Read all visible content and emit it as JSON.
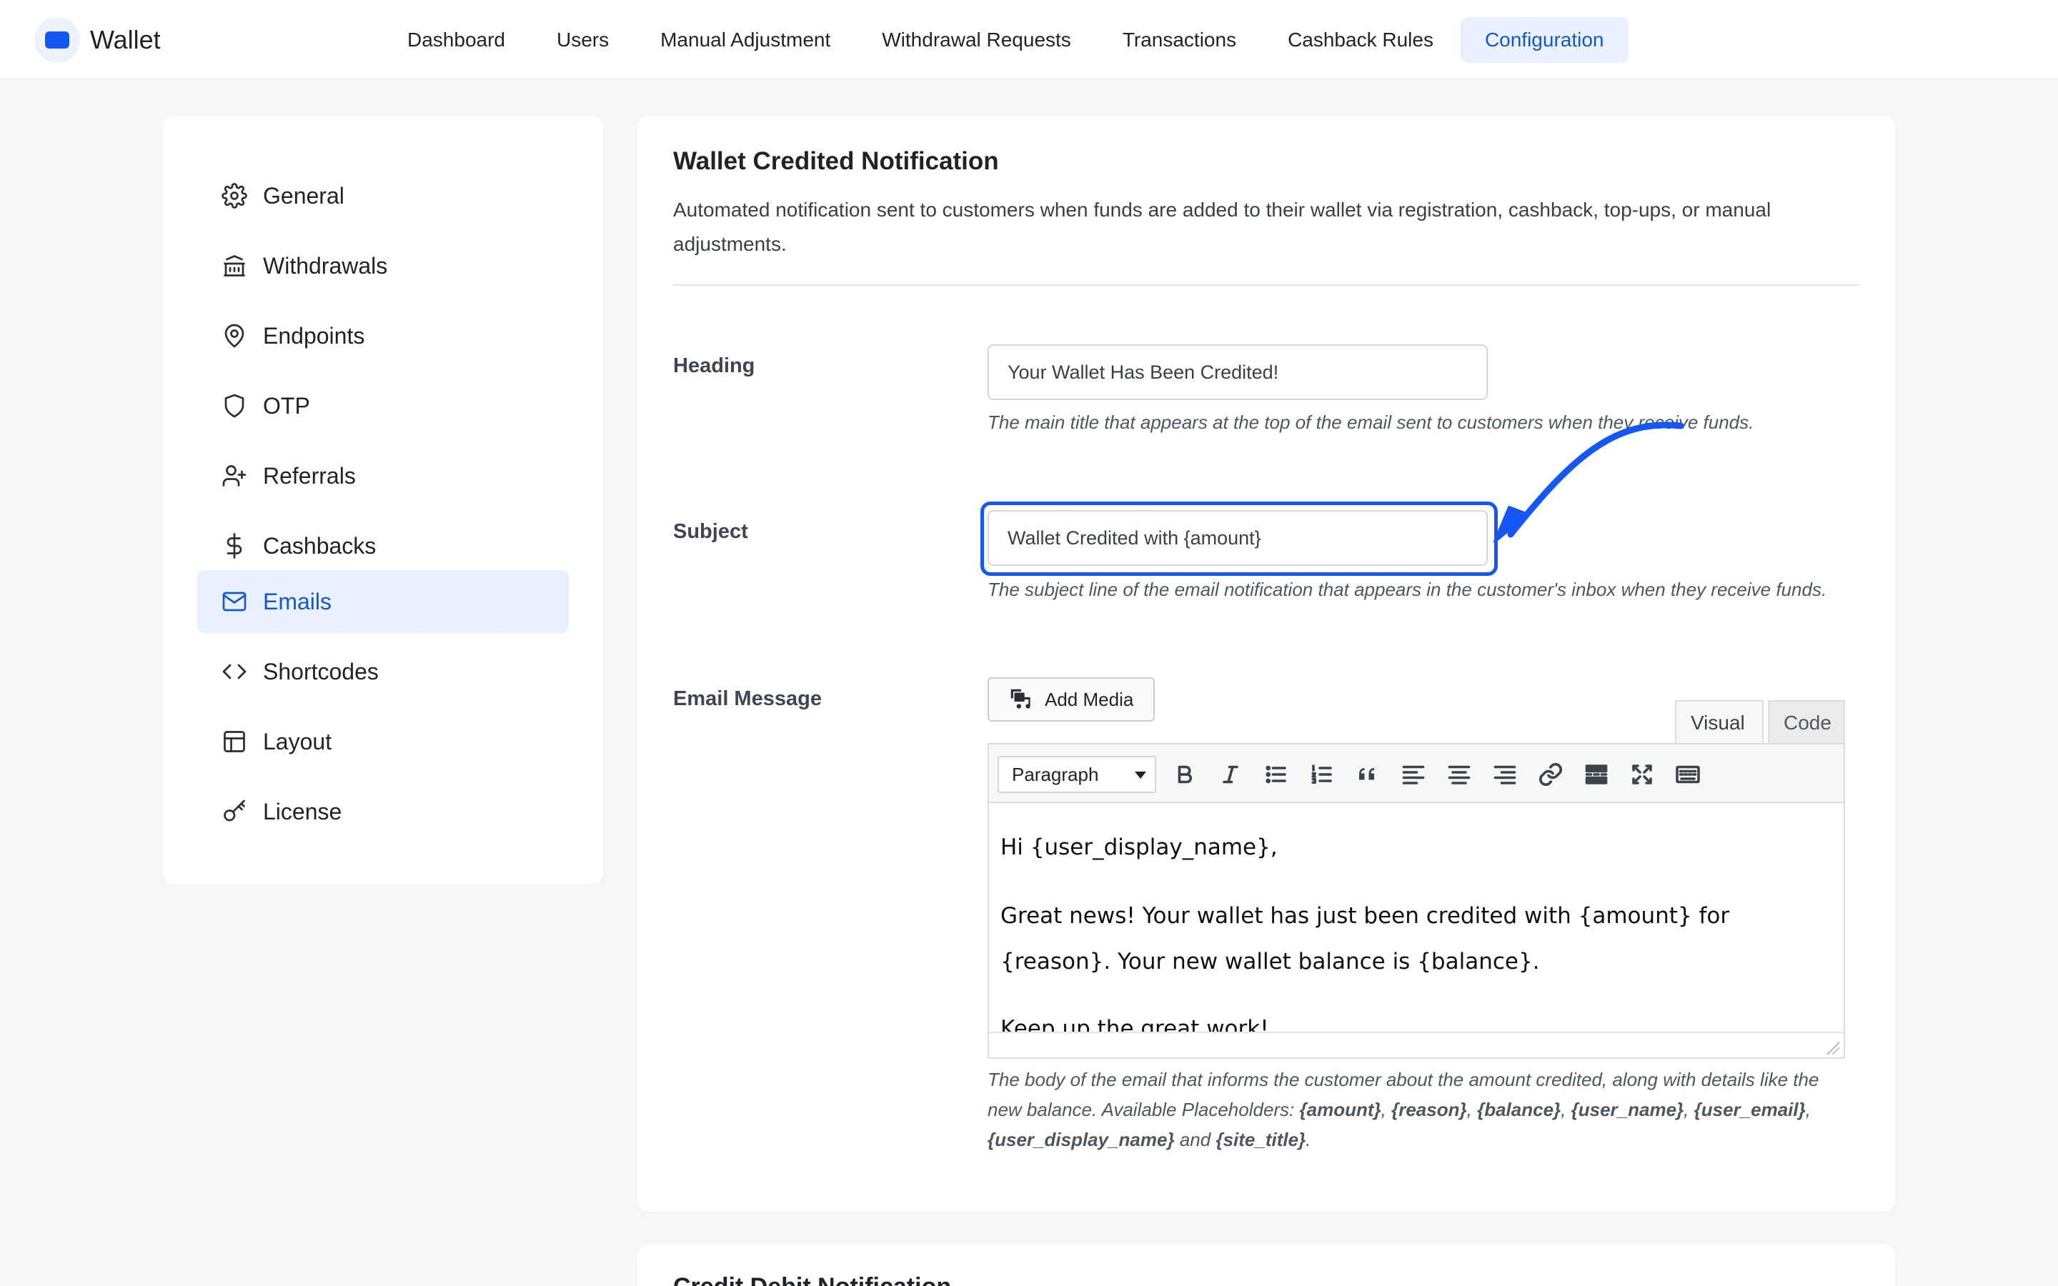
{
  "brand": {
    "name": "Wallet",
    "accent": "#1557f5"
  },
  "nav": {
    "items": [
      {
        "label": "Dashboard"
      },
      {
        "label": "Users"
      },
      {
        "label": "Manual Adjustment"
      },
      {
        "label": "Withdrawal Requests"
      },
      {
        "label": "Transactions"
      },
      {
        "label": "Cashback Rules"
      },
      {
        "label": "Configuration"
      }
    ],
    "active": "Configuration"
  },
  "sidebar": {
    "items": [
      {
        "label": "General",
        "icon": "gear-icon"
      },
      {
        "label": "Withdrawals",
        "icon": "bank-icon"
      },
      {
        "label": "Endpoints",
        "icon": "map-pin-icon"
      },
      {
        "label": "OTP",
        "icon": "shield-icon"
      },
      {
        "label": "Referrals",
        "icon": "user-plus-icon"
      },
      {
        "label": "Cashbacks",
        "icon": "dollar-icon"
      },
      {
        "label": "Emails",
        "icon": "mail-icon"
      },
      {
        "label": "Shortcodes",
        "icon": "code-icon"
      },
      {
        "label": "Layout",
        "icon": "layout-icon"
      },
      {
        "label": "License",
        "icon": "key-icon"
      }
    ],
    "active": "Emails"
  },
  "section": {
    "title": "Wallet Credited Notification",
    "description": "Automated notification sent to customers when funds are added to their wallet via registration, cashback, top-ups, or manual adjustments."
  },
  "fields": {
    "heading": {
      "label": "Heading",
      "value": "Your Wallet Has Been Credited!",
      "help": "The main title that appears at the top of the email sent to customers when they receive funds."
    },
    "subject": {
      "label": "Subject",
      "value": "Wallet Credited with {amount}",
      "help": "The subject line of the email notification that appears in the customer's inbox when they receive funds."
    },
    "message": {
      "label": "Email Message",
      "add_media": "Add Media",
      "tabs": {
        "visual": "Visual",
        "code": "Code"
      },
      "format": "Paragraph",
      "paragraphs": [
        "Hi {user_display_name},",
        "Great news! Your wallet has just been credited with {amount} for {reason}. Your new wallet balance is {balance}.",
        "Keep up the great work!"
      ],
      "help_intro": "The body of the email that informs the customer about the amount credited, along with details like the new balance. Available Placeholders:",
      "placeholders": [
        "{amount}",
        "{reason}",
        "{balance}",
        "{user_name}",
        "{user_email}",
        "{user_display_name}"
      ],
      "last_placeholder": "{site_title}",
      "sep": ",",
      "and_text": "and",
      "period": "."
    }
  },
  "next_section": {
    "title": "Credit Debit Notification"
  },
  "colors": {
    "focus": "#1557f5",
    "active_bg": "#eaf1fe",
    "active_text": "#1557c9"
  }
}
